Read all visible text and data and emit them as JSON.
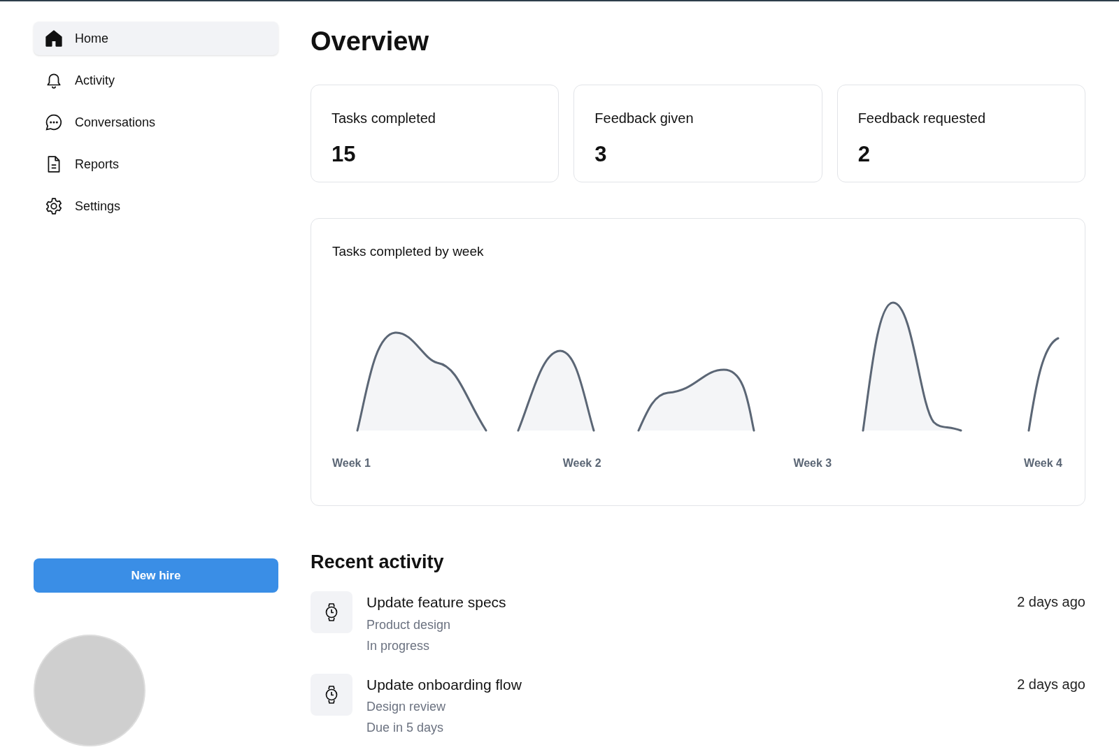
{
  "sidebar": {
    "items": [
      {
        "label": "Home",
        "kind": "home",
        "selected": true
      },
      {
        "label": "Activity",
        "kind": "bell",
        "selected": false
      },
      {
        "label": "Conversations",
        "kind": "chat",
        "selected": false
      },
      {
        "label": "Reports",
        "kind": "document",
        "selected": false
      },
      {
        "label": "Settings",
        "kind": "gear",
        "selected": false
      }
    ],
    "button": "New hire"
  },
  "title": "Overview",
  "stats": [
    {
      "label": "Tasks completed",
      "value": "15"
    },
    {
      "label": "Feedback given",
      "value": "3"
    },
    {
      "label": "Feedback requested",
      "value": "2"
    }
  ],
  "chart": {
    "title": "Tasks completed by week",
    "x_labels": [
      "Week 1",
      "Week 2",
      "Week 3",
      "Week 4"
    ]
  },
  "recent_activity": {
    "heading": "Recent activity",
    "items": [
      {
        "title": "Update feature specs",
        "subtitle": "Product design",
        "status": "In progress",
        "time": "2 days ago"
      },
      {
        "title": "Update onboarding flow",
        "subtitle": "Design review",
        "status": "Due in 5 days",
        "time": "2 days ago"
      }
    ]
  }
}
